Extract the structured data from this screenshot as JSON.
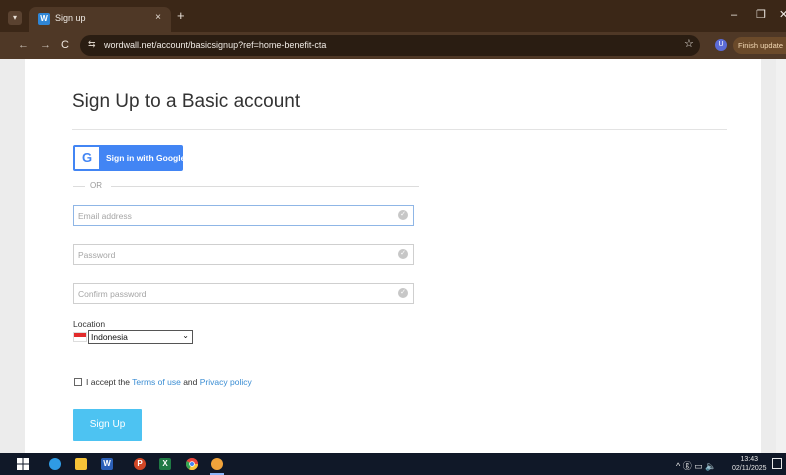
{
  "browser": {
    "tab_title": "Sign up",
    "tab_favicon": "W",
    "tab_close": "×",
    "new_tab": "+",
    "url": "wordwall.net/account/basicsignup?ref=home-benefit-cta",
    "profile_initial": "U",
    "finish_update": "Finish update",
    "window_controls": {
      "minimize": "–",
      "restore": "❐",
      "close": "✕"
    },
    "nav": {
      "back": "←",
      "forward": "→",
      "reload": "C"
    },
    "star": "☆",
    "site_info": "⇆"
  },
  "page": {
    "title": "Sign Up to a Basic account",
    "google_button": "Sign in with Google",
    "google_letter": "G",
    "or_text": "OR",
    "email": {
      "placeholder": "Email address",
      "value": ""
    },
    "password": {
      "placeholder": "Password",
      "value": ""
    },
    "confirm_password": {
      "placeholder": "Confirm password",
      "value": ""
    },
    "location_label": "Location",
    "location_value": "Indonesia",
    "terms_prefix": "I accept the",
    "terms_link": "Terms of use",
    "terms_and": "and",
    "privacy_link": "Privacy policy",
    "signup_button": "Sign Up"
  },
  "taskbar": {
    "icons": [
      "windows-icon",
      "cortana-icon",
      "file-explorer-icon",
      "word-icon",
      "powerpoint-icon",
      "excel-icon",
      "chrome-icon",
      "chrome-canary-icon"
    ],
    "tray_text": "^ ⓖ ▭ 🔈",
    "time": "13:43",
    "date": "02/11/2025"
  },
  "colors": {
    "browser_frame": "#3b2717",
    "toolbar": "#4f3826",
    "google_blue": "#4285f4",
    "signup_button": "#4dc3f2",
    "link": "#3a8dd3",
    "taskbar": "#101828"
  }
}
